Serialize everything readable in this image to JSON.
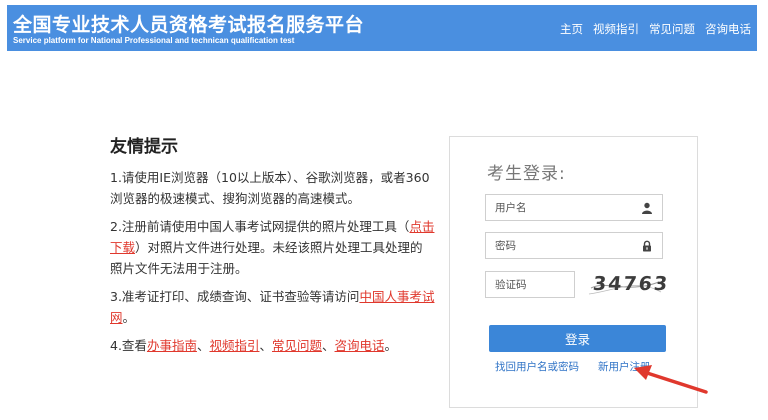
{
  "header": {
    "title": "全国专业技术人员资格考试报名服务平台",
    "subtitle": "Service platform for National Professional and technican qualification test",
    "nav": [
      "主页",
      "视频指引",
      "常见问题",
      "咨询电话"
    ]
  },
  "tips": {
    "title": "友情提示",
    "item1": "1.请使用IE浏览器（10以上版本）、谷歌浏览器，或者360浏览器的极速模式、搜狗浏览器的高速模式。",
    "item2_pre": "2.注册前请使用中国人事考试网提供的照片处理工具（",
    "item2_link": "点击下载",
    "item2_post": "）对照片文件进行处理。未经该照片处理工具处理的照片文件无法用于注册。",
    "item3_pre": "3.准考证打印、成绩查询、证书查验等请访问",
    "item3_link": "中国人事考试网",
    "item3_post": "。",
    "item4_pre": "4.查看",
    "item4_links": [
      "办事指南",
      "视频指引",
      "常见问题",
      "咨询电话"
    ],
    "item4_sep": "、",
    "item4_post": "。"
  },
  "login": {
    "title": "考生登录:",
    "username_placeholder": "用户名",
    "password_placeholder": "密码",
    "captcha_placeholder": "验证码",
    "captcha_text": "34763",
    "login_button": "登录",
    "find_account": "找回用户名或密码",
    "register": "新用户注册"
  },
  "icons": {
    "username": "user-icon",
    "password": "lock-icon",
    "annotation": "arrow-icon"
  },
  "colors": {
    "header": "#4a8fe0",
    "button": "#3b86d8",
    "link": "#2f73c6",
    "highlight": "#e0382d"
  }
}
